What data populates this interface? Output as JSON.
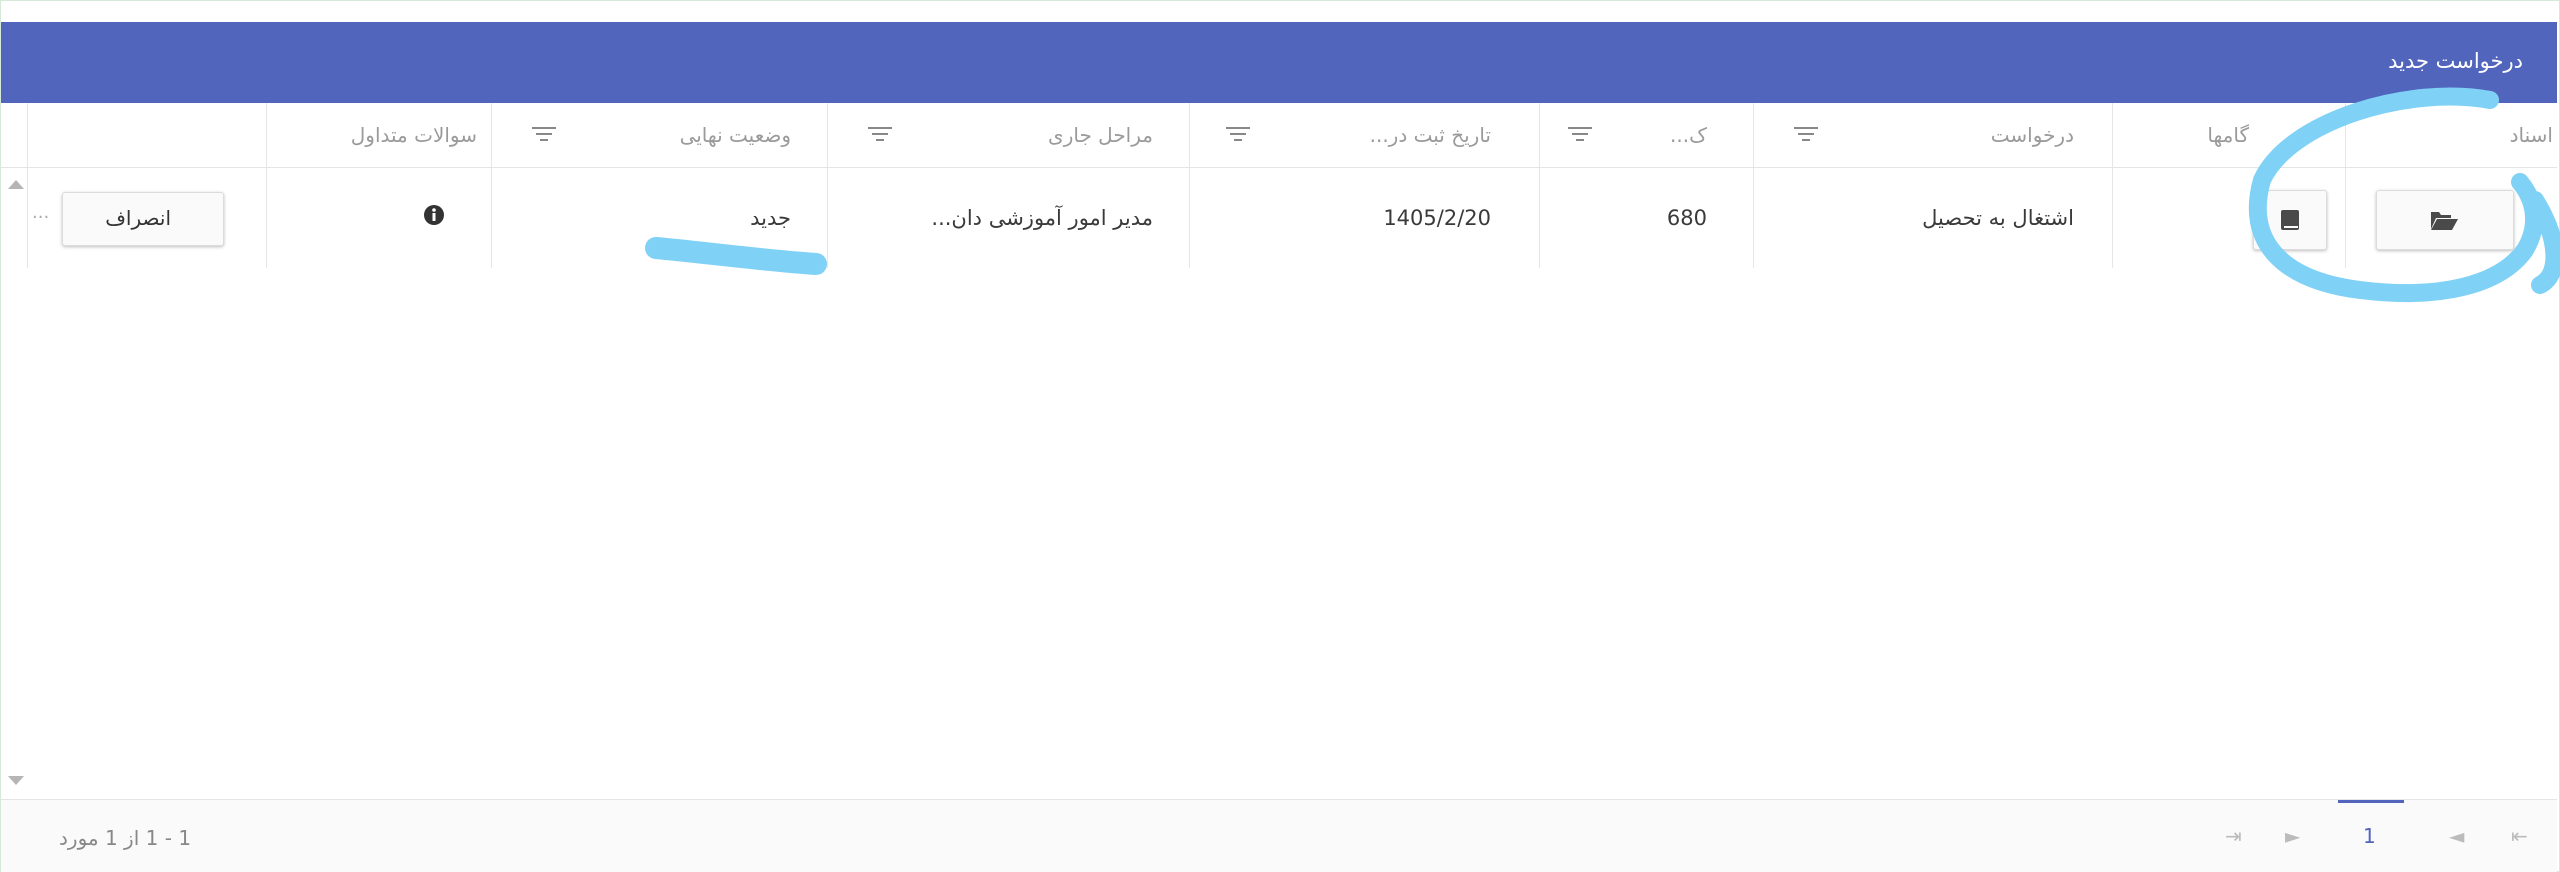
{
  "toolbar": {
    "title": "درخواست جدید"
  },
  "columns": {
    "documents": "اسناد",
    "steps": "گامها",
    "request": "درخواست",
    "code": "ک...",
    "date": "تاریخ ثبت در...",
    "stages": "مراحل جاری",
    "final_status": "وضعیت نهایی",
    "faq": "سوالات متداول"
  },
  "rows": [
    {
      "request": "اشتغال به تحصیل",
      "code": "680",
      "date": "1405/2/20",
      "stage": "مدیر امور آموزشی دان...",
      "final_status": "جدید",
      "action": "انصراف",
      "overflow": "..."
    }
  ],
  "pager": {
    "info": "1 - 1 از 1 مورد",
    "current_page": "1",
    "first": "⇤",
    "prev": "◄",
    "next": "►",
    "last": "⇥"
  },
  "icons": [
    "folder-open-icon",
    "book-icon",
    "info-circle-icon",
    "filter-icon"
  ],
  "colors": {
    "accent": "#5165bd",
    "annotation": "#7fd1f5"
  }
}
